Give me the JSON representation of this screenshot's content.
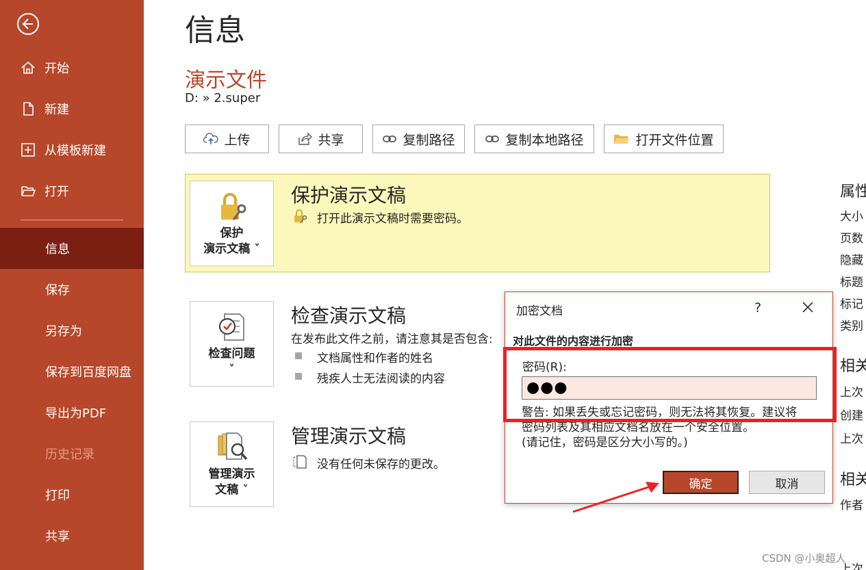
{
  "sidebar": {
    "back": "back",
    "items": [
      {
        "label": "开始",
        "icon": "home-icon"
      },
      {
        "label": "新建",
        "icon": "new-document-icon"
      },
      {
        "label": "从模板新建",
        "icon": "template-icon"
      },
      {
        "label": "打开",
        "icon": "open-folder-icon"
      },
      {
        "label": "信息"
      },
      {
        "label": "保存"
      },
      {
        "label": "另存为"
      },
      {
        "label": "保存到百度网盘"
      },
      {
        "label": "导出为PDF"
      },
      {
        "label": "历史记录"
      },
      {
        "label": "打印"
      },
      {
        "label": "共享"
      }
    ],
    "active": "信息",
    "disabled": "历史记录"
  },
  "main": {
    "page_title": "信息",
    "doc_title": "演示文件",
    "doc_path": "D: » 2.super",
    "toolbar": {
      "upload": "上传",
      "share": "共享",
      "copy_path": "复制路径",
      "copy_local_path": "复制本地路径",
      "open_location": "打开文件位置"
    },
    "protect": {
      "button_line1": "保护",
      "button_line2": "演示文稿 ˅",
      "title": "保护演示文稿",
      "desc": "打开此演示文稿时需要密码。"
    },
    "inspect": {
      "button_line1": "检查问题",
      "button_line2": "˅",
      "title": "检查演示文稿",
      "desc": "在发布此文件之前，请注意其是否包含:",
      "bullets": [
        "文档属性和作者的姓名",
        "残疾人士无法阅读的内容"
      ]
    },
    "manage": {
      "button_line1": "管理演示",
      "button_line2": "文稿 ˅",
      "title": "管理演示文稿",
      "desc": "没有任何未保存的更改。"
    }
  },
  "properties": {
    "heading": "属性",
    "rows": [
      "大小",
      "页数",
      "隐藏",
      "标题",
      "标记",
      "类别"
    ],
    "related_dates": "相关",
    "date_rows": [
      "上次",
      "创建",
      "上次"
    ],
    "related_people": "相关",
    "people_rows": [
      "作者"
    ],
    "tail": "上次"
  },
  "dialog": {
    "title": "加密文档",
    "help": "?",
    "heading": "对此文件的内容进行加密",
    "password_label": "密码(R):",
    "password_value": "●●●",
    "warning_line1": "警告: 如果丢失或忘记密码，则无法将其恢复。建议将",
    "warning_line2": "密码列表及其相应文档名放在一个安全位置。",
    "warning_line3": "(请记住，密码是区分大小写的。)",
    "ok": "确定",
    "cancel": "取消"
  },
  "watermark": "CSDN @小奥超人",
  "colors": {
    "accent": "#b7472a",
    "active_nav": "#7a1f12",
    "protect_bg": "#fcf7bb",
    "highlight": "#f02020"
  }
}
